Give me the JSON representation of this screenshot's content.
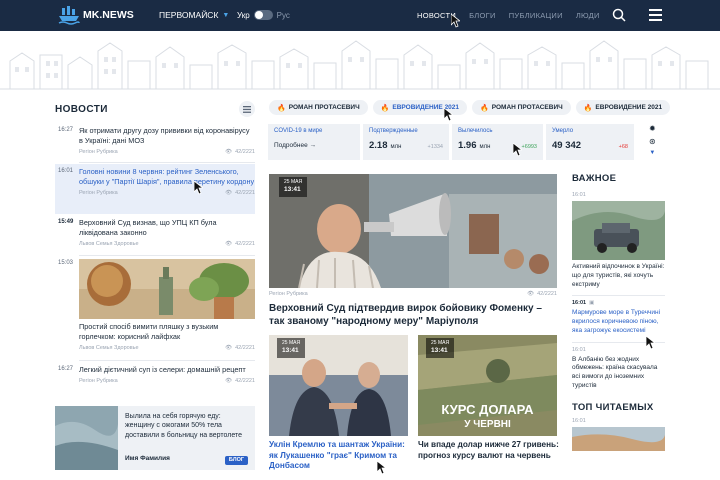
{
  "header": {
    "logo": "MK.NEWS",
    "city": "ПЕРВОМАЙСК",
    "lang_on": "Укр",
    "lang_off": "Рус",
    "nav": [
      {
        "label": "НОВОСТИ",
        "active": true
      },
      {
        "label": "БЛОГИ",
        "active": false
      },
      {
        "label": "ПУБЛИКАЦИИ",
        "active": false
      },
      {
        "label": "ЛЮДИ",
        "active": false
      }
    ]
  },
  "sidebar": {
    "title": "НОВОСТИ",
    "items": [
      {
        "time": "16:27",
        "text": "Як отримати другу дозу прививки від коронавірусу в Україні: дані МОЗ",
        "meta": "Регіон Рубрика",
        "views": "42/2221"
      },
      {
        "time": "16:01",
        "text": "Головні новини 8 червня: рейтинг Зеленського, обшуки у \"Партії Шарія\", правила перетину кордону",
        "meta": "Регіон Рубрика",
        "views": "42/2221"
      },
      {
        "time": "15:49",
        "text": "Верховний Суд визнав, що УПЦ КП була ліквідована законно",
        "meta": "Львов Семья Здоровье",
        "views": "42/2221"
      },
      {
        "time": "15:03",
        "text": "Простий спосіб вимити пляшку з вузьким горлечком: корисний лайфхак",
        "meta": "Львов Семья Здоровье",
        "views": "42/2221"
      },
      {
        "time": "16:27",
        "text": "Легкий дієтичний суп із селери: домашній рецепт",
        "meta": "Регіон Рубрика",
        "views": "42/2221"
      }
    ],
    "blog": {
      "text": "Вылила на себя горячую еду: женщину с ожогами 50% тела доставили в больницу на вертолете",
      "author": "Имя Фамилия",
      "badge": "БЛОГ"
    }
  },
  "tags": [
    {
      "label": "РОМАН ПРОТАСЕВИЧ"
    },
    {
      "label": "ЕВРОВИДЕНИЕ 2021"
    },
    {
      "label": "РОМАН ПРОТАСЕВИЧ"
    },
    {
      "label": "ЕВРОВИДЕНИЕ 2021"
    }
  ],
  "covid": {
    "title": "COVID-19 в мире",
    "more": "Подробнее →",
    "confirmed_label": "Подтвержденные",
    "confirmed": "2.18",
    "confirmed_unit": "млн",
    "confirmed_delta": "+1334",
    "recovered_label": "Вылечилось",
    "recovered": "1.96",
    "recovered_unit": "млн",
    "recovered_delta": "+6993",
    "died_label": "Умерло",
    "died": "49 342",
    "died_delta": "+68"
  },
  "main": {
    "date": "25 МАЯ",
    "time": "13:41",
    "meta": "Регіон Рубрика",
    "views": "42/2221",
    "title": "Верховний Суд підтвердив вирок бойовику Фоменку – так званому \"народному меру\" Маріуполя"
  },
  "card2": {
    "date": "25 МАЯ",
    "time": "13:41",
    "title": "Уклін Кремлю та шантаж України: як Лукашенко \"грає\" Кримом та Донбасом"
  },
  "card3": {
    "date": "25 МАЯ",
    "time": "13:41",
    "overlay1": "КУРС ДОЛАРА",
    "overlay2": "У ЧЕРВНІ",
    "title": "Чи впаде долар нижче 27 гривень: прогноз курсу валют на червень"
  },
  "important": {
    "title": "ВАЖНОЕ",
    "items": [
      {
        "time": "16:01",
        "text": "Активний відпочинок в Україні: що для туристів, які хочуть екстриму"
      },
      {
        "time": "16:01",
        "text": "Мармурове море в Туреччині вкрилося коричневою піною, яка загрожує екосистемі"
      },
      {
        "time": "16:01",
        "text": "В Албанію без жодних обмежень: країна скасувала всі вимоги до іноземних туристів"
      }
    ]
  },
  "top": {
    "title": "ТОП ЧИТАЕМЫХ",
    "time": "16:01"
  }
}
